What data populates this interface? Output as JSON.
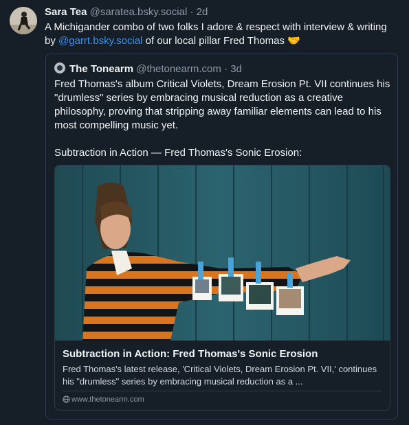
{
  "post": {
    "author_name": "Sara Tea",
    "author_handle": "@saratea.bsky.social",
    "separator": "·",
    "age": "2d",
    "text_before": "A Michigander combo of two folks I adore & respect with interview & writing by ",
    "mention": "@garrt.bsky.social",
    "text_after": " of our local pillar Fred Thomas 🤝"
  },
  "quote": {
    "author_name": "The Tonearm",
    "author_handle": "@thetonearm.com",
    "separator": "·",
    "age": "3d",
    "text": "Fred Thomas's album Critical Violets, Dream Erosion Pt. VII continues his \"drumless\" series by embracing musical reduction as a creative philosophy, proving that stripping away familiar elements can lead to his most compelling music yet.\n\nSubtraction in Action — Fred Thomas's Sonic Erosion:"
  },
  "card": {
    "title": "Subtraction in Action: Fred Thomas's Sonic Erosion",
    "description": "Fred Thomas's latest release, 'Critical Violets, Dream Erosion Pt. VII,' continues his \"drumless\" series by embracing musical reduction as a ...",
    "domain": "www.thetonearm.com"
  },
  "colors": {
    "background": "#161e27",
    "link": "#3b93f6",
    "muted": "#8d9aa8",
    "border": "#2e3e50"
  },
  "icons": [
    "avatar",
    "quote-avatar",
    "globe-icon",
    "article-photo"
  ]
}
